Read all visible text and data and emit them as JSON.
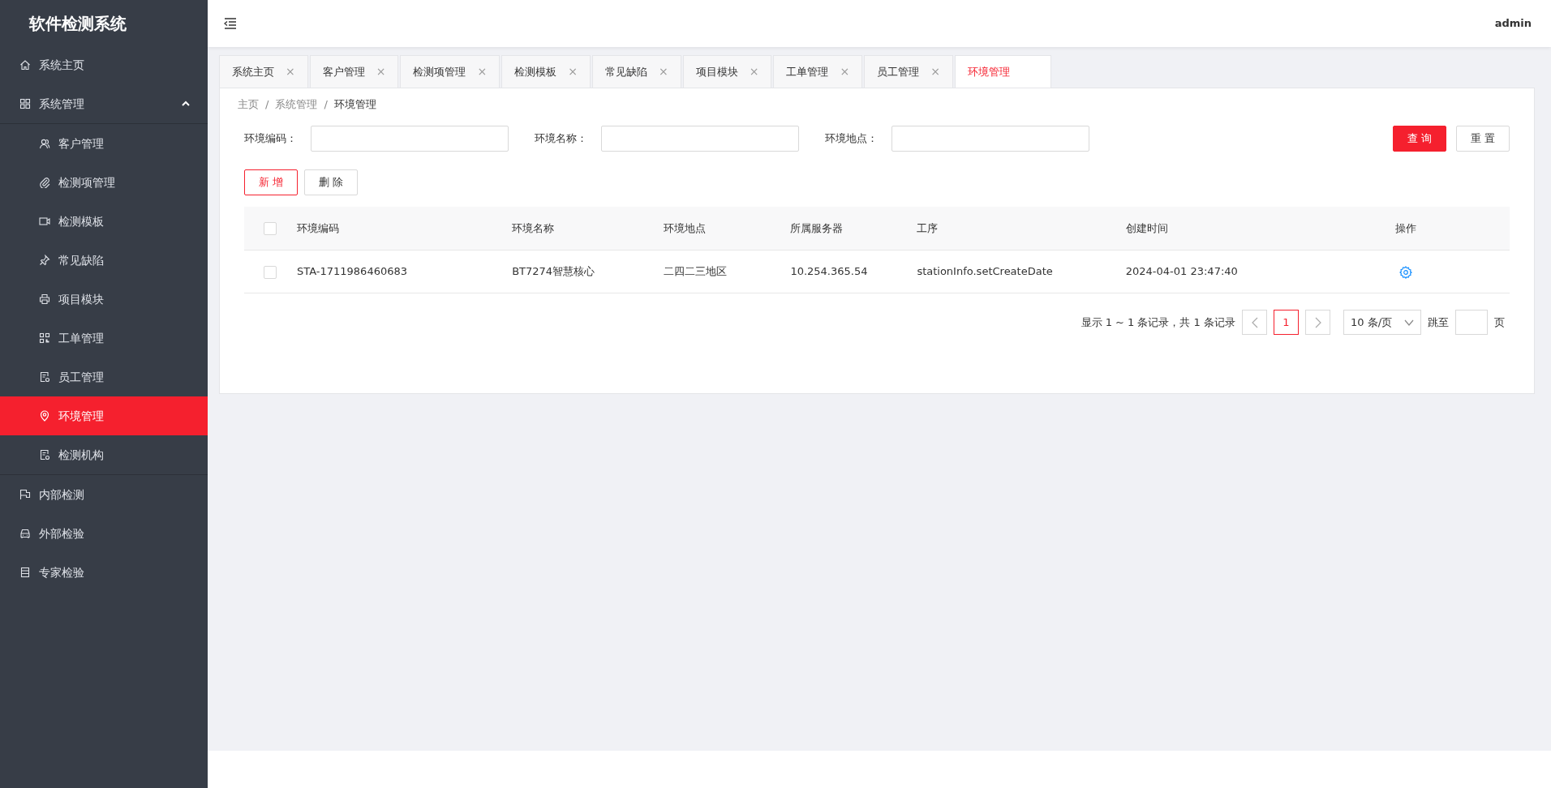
{
  "app": {
    "title": "软件检测系统"
  },
  "sidebar": {
    "items": [
      {
        "label": "系统主页",
        "selected": false
      },
      {
        "label": "系统管理",
        "selected": false,
        "expanded": true,
        "children": [
          {
            "label": "客户管理",
            "selected": false
          },
          {
            "label": "检测项管理",
            "selected": false
          },
          {
            "label": "检测模板",
            "selected": false
          },
          {
            "label": "常见缺陷",
            "selected": false
          },
          {
            "label": "项目模块",
            "selected": false
          },
          {
            "label": "工单管理",
            "selected": false
          },
          {
            "label": "员工管理",
            "selected": false
          },
          {
            "label": "环境管理",
            "selected": true
          },
          {
            "label": "检测机构",
            "selected": false
          }
        ]
      },
      {
        "label": "内部检测",
        "selected": false
      },
      {
        "label": "外部检验",
        "selected": false
      },
      {
        "label": "专家检验",
        "selected": false
      }
    ]
  },
  "header": {
    "user": "admin"
  },
  "tabs": [
    {
      "label": "系统主页",
      "selected": false,
      "close": "×"
    },
    {
      "label": "客户管理",
      "selected": false,
      "close": "×"
    },
    {
      "label": "检测项管理",
      "selected": false,
      "close": "×"
    },
    {
      "label": "检测模板",
      "selected": false,
      "close": "×"
    },
    {
      "label": "常见缺陷",
      "selected": false,
      "close": "×"
    },
    {
      "label": "项目模块",
      "selected": false,
      "close": "×"
    },
    {
      "label": "工单管理",
      "selected": false,
      "close": "×"
    },
    {
      "label": "员工管理",
      "selected": false,
      "close": "×"
    },
    {
      "label": "环境管理",
      "selected": true
    }
  ],
  "breadcrumb": {
    "separator": "/",
    "items": [
      "主页",
      "系统管理",
      "环境管理"
    ]
  },
  "filters": [
    {
      "label": "环境编码："
    },
    {
      "label": "环境名称："
    },
    {
      "label": "环境地点："
    }
  ],
  "filter_buttons": [
    {
      "label": "查 询",
      "kind": "primary"
    },
    {
      "label": "重 置",
      "kind": "default"
    }
  ],
  "toolbar": [
    {
      "label": "新 增",
      "kind": "outline"
    },
    {
      "label": "删 除",
      "kind": "default"
    }
  ],
  "table": {
    "select_all": {
      "checked": false
    },
    "columns": [
      "环境编码",
      "环境名称",
      "环境地点",
      "所属服务器",
      "工序",
      "创建时间",
      "操作"
    ],
    "rows": [
      {
        "checked": false,
        "cells": [
          "STA-1711986460683",
          "BT7274智慧核心",
          "二四二三地区",
          "10.254.365.54",
          "stationInfo.setCreateDate",
          "2024-04-01 23:47:40"
        ]
      }
    ]
  },
  "pagination": {
    "summary": "显示 1 ~ 1 条记录，共 1 条记录",
    "pages": [
      {
        "label": "1",
        "selected": true
      }
    ],
    "page_size": "10 条/页",
    "jump_label": "跳至",
    "page_unit": "页"
  }
}
